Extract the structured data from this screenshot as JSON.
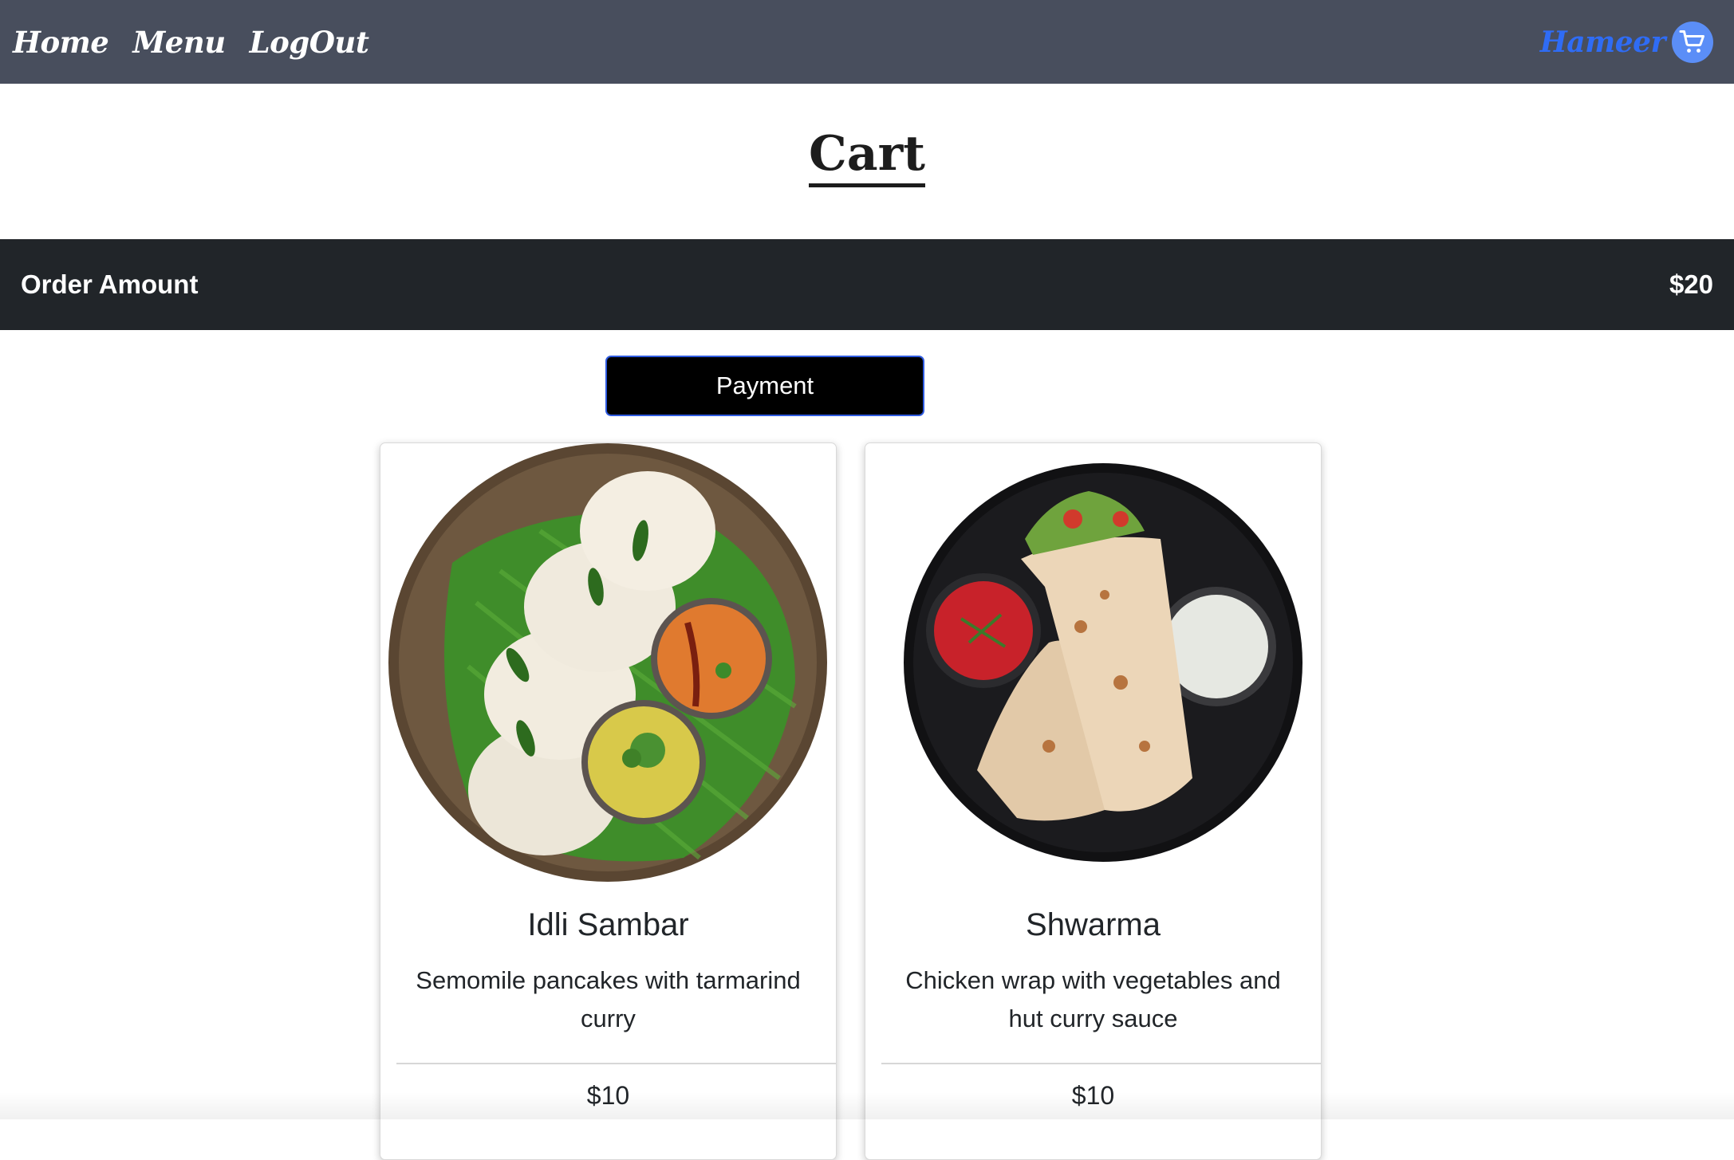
{
  "navbar": {
    "links": [
      {
        "label": "Home"
      },
      {
        "label": "Menu"
      },
      {
        "label": "LogOut"
      }
    ],
    "user_name": "Hameer",
    "cart_icon": "shopping-cart-icon"
  },
  "page": {
    "title": "Cart"
  },
  "order": {
    "label": "Order Amount",
    "total": "$20"
  },
  "payment_button": {
    "label": "Payment"
  },
  "cart_items": [
    {
      "name": "Idli Sambar",
      "description": "Semomile pancakes with tarmarind curry",
      "price": "$10",
      "image": "idli-sambar-image"
    },
    {
      "name": "Shwarma",
      "description": "Chicken wrap with vegetables and hut curry sauce",
      "price": "$10",
      "image": "shwarma-image"
    }
  ],
  "colors": {
    "navbar_bg": "#484e5d",
    "user_name": "#2f6cf5",
    "order_bar_bg": "#212529",
    "payment_bg": "#000000",
    "payment_border": "#2f5be0"
  }
}
